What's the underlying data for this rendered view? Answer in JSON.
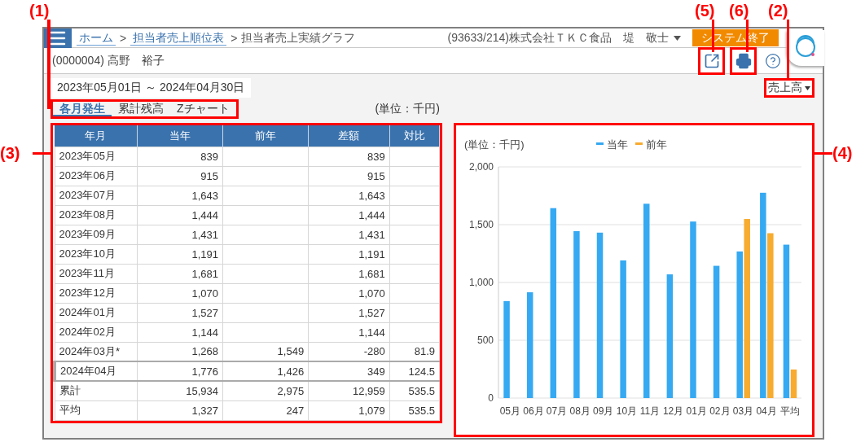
{
  "header": {
    "breadcrumb": [
      {
        "kind": "link",
        "label": "ホーム"
      },
      {
        "kind": "separator",
        "label": ">"
      },
      {
        "kind": "link",
        "label": "担当者売上順位表"
      },
      {
        "kind": "separator",
        "label": ">"
      },
      {
        "kind": "current",
        "label": "担当者売上実績グラフ"
      }
    ],
    "account": "(93633/214)株式会社ＴＫＣ食品　堤　敬士",
    "exit_button": "システム終了"
  },
  "person": "(0000004) 高野　裕子",
  "period": "2023年05月01日 ～ 2024年04月30日",
  "measure_dropdown": "売上高",
  "tabs": [
    {
      "label": "各月発生",
      "selected": true
    },
    {
      "label": "累計残高",
      "selected": false
    },
    {
      "label": "Zチャート",
      "selected": false
    }
  ],
  "unit": "(単位：千円)",
  "table": {
    "columns": [
      "年月",
      "当年",
      "前年",
      "差額",
      "対比"
    ],
    "rows": [
      {
        "cells": [
          "2023年05月",
          "839",
          "",
          "839",
          ""
        ],
        "selected": false
      },
      {
        "cells": [
          "2023年06月",
          "915",
          "",
          "915",
          ""
        ],
        "selected": false
      },
      {
        "cells": [
          "2023年07月",
          "1,643",
          "",
          "1,643",
          ""
        ],
        "selected": false
      },
      {
        "cells": [
          "2023年08月",
          "1,444",
          "",
          "1,444",
          ""
        ],
        "selected": false
      },
      {
        "cells": [
          "2023年09月",
          "1,431",
          "",
          "1,431",
          ""
        ],
        "selected": false
      },
      {
        "cells": [
          "2023年10月",
          "1,191",
          "",
          "1,191",
          ""
        ],
        "selected": false
      },
      {
        "cells": [
          "2023年11月",
          "1,681",
          "",
          "1,681",
          ""
        ],
        "selected": false
      },
      {
        "cells": [
          "2023年12月",
          "1,070",
          "",
          "1,070",
          ""
        ],
        "selected": false
      },
      {
        "cells": [
          "2024年01月",
          "1,527",
          "",
          "1,527",
          ""
        ],
        "selected": false
      },
      {
        "cells": [
          "2024年02月",
          "1,144",
          "",
          "1,144",
          ""
        ],
        "selected": false
      },
      {
        "cells": [
          "2024年03月*",
          "1,268",
          "1,549",
          "-280",
          "81.9"
        ],
        "selected": false
      },
      {
        "cells": [
          "2024年04月",
          "1,776",
          "1,426",
          "349",
          "124.5"
        ],
        "selected": true
      },
      {
        "cells": [
          "累計",
          "15,934",
          "2,975",
          "12,959",
          "535.5"
        ],
        "selected": false
      },
      {
        "cells": [
          "平均",
          "1,327",
          "247",
          "1,079",
          "535.5"
        ],
        "selected": false
      }
    ]
  },
  "chart": {
    "chart_data": {
      "type": "bar",
      "grid": true,
      "legend": "top",
      "ylabel": "(単位：千円)",
      "categories": [
        "05月",
        "06月",
        "07月",
        "08月",
        "09月",
        "10月",
        "11月",
        "12月",
        "01月",
        "02月",
        "03月",
        "04月",
        "平均"
      ],
      "series": [
        {
          "name": "当年",
          "color": "#35a9f2",
          "values": [
            839,
            915,
            1643,
            1444,
            1431,
            1191,
            1681,
            1070,
            1527,
            1144,
            1268,
            1776,
            1327
          ]
        },
        {
          "name": "前年",
          "color": "#f7ab2f",
          "values": [
            null,
            null,
            null,
            null,
            null,
            null,
            null,
            null,
            null,
            null,
            1549,
            1426,
            247
          ]
        }
      ],
      "ylim": [
        0,
        2000
      ],
      "yticks": [
        {
          "value": 0,
          "label": "0"
        },
        {
          "value": 500,
          "label": "500"
        },
        {
          "value": 1000,
          "label": "1,000"
        },
        {
          "value": 1500,
          "label": "1,500"
        },
        {
          "value": 2000,
          "label": "2,000"
        }
      ]
    }
  },
  "annotations": [
    {
      "label": "(1)"
    },
    {
      "label": "(2)"
    },
    {
      "label": "(3)"
    },
    {
      "label": "(4)"
    },
    {
      "label": "(5)"
    },
    {
      "label": "(6)"
    }
  ]
}
